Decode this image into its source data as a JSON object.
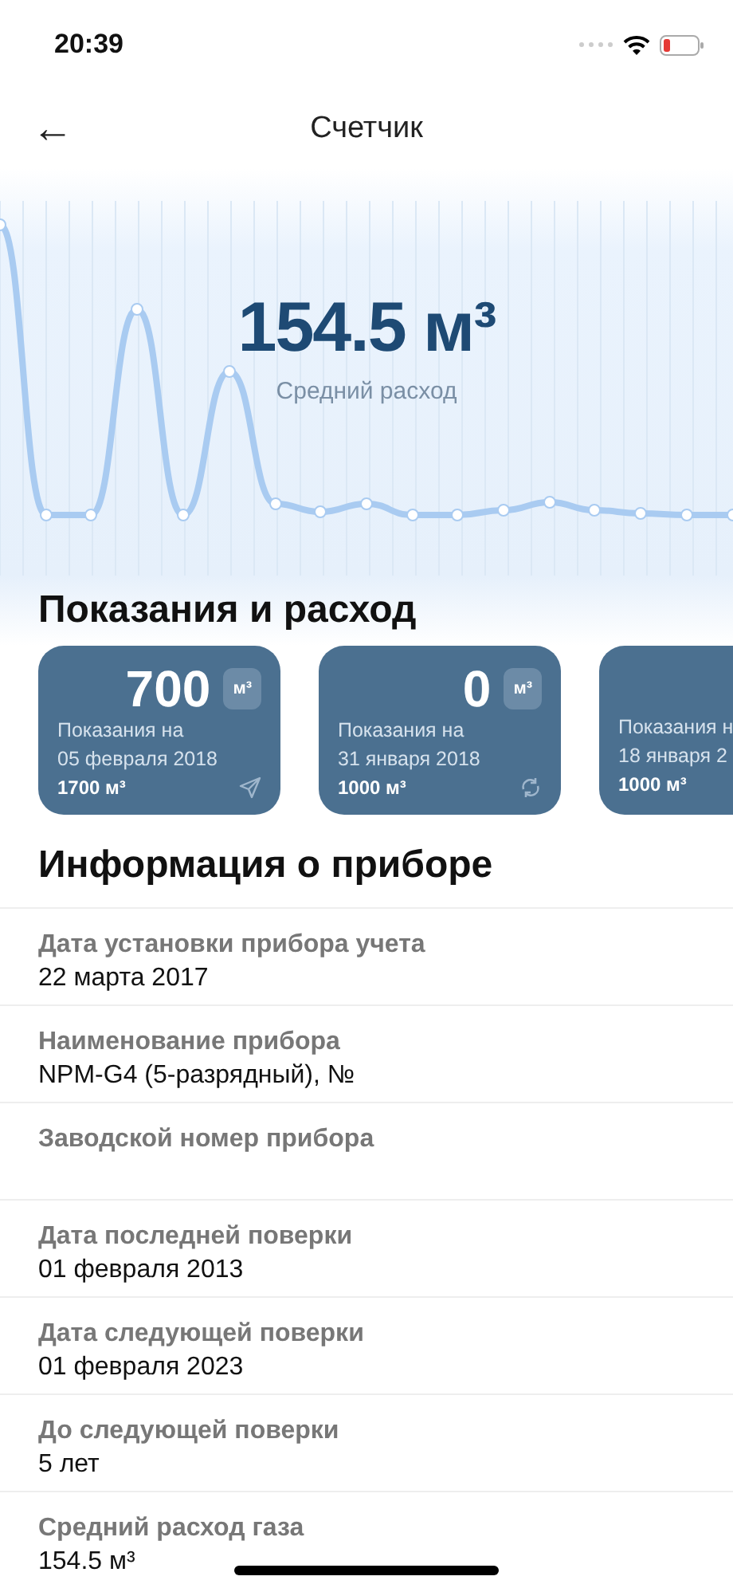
{
  "status_bar": {
    "time": "20:39"
  },
  "header": {
    "back": "←",
    "title": "Счетчик"
  },
  "summary": {
    "value": "154.5 м³",
    "caption": "Средний расход"
  },
  "readings": {
    "title": "Показания и расход",
    "cards": [
      {
        "value": "700",
        "unit": "м³",
        "caption": "Показания на",
        "date": "05 февраля 2018",
        "total": "1700 м³",
        "kind": "sent"
      },
      {
        "value": "0",
        "unit": "м³",
        "caption": "Показания на",
        "date": "31 января 2018",
        "total": "1000 м³",
        "kind": "synced"
      },
      {
        "caption": "Показания н",
        "date": "18 января 2",
        "total": "1000 м³"
      }
    ]
  },
  "info": {
    "title": "Информация о приборе",
    "rows": [
      {
        "label": "Дата установки прибора учета",
        "value": "22 марта 2017"
      },
      {
        "label": "Наименование прибора",
        "value": "NPM-G4 (5-разрядный), №"
      },
      {
        "label": "Заводской номер прибора"
      },
      {
        "label": "Дата последней поверки",
        "value": "01 февраля 2013"
      },
      {
        "label": "Дата следующей поверки",
        "value": "01 февраля 2023"
      },
      {
        "label": "До следующей поверки",
        "value": "5 лет"
      },
      {
        "label": "Средний расход газа",
        "value": "154.5 м³"
      }
    ]
  }
}
